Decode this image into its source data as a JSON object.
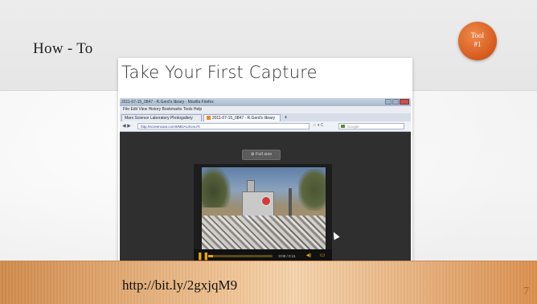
{
  "slide": {
    "title": "How - To",
    "badge": {
      "line1": "Tool",
      "line2": "#1"
    },
    "footer_url": "http://bit.ly/2gxjqM9",
    "page_number": "7"
  },
  "screenshot": {
    "heading": "Take Your First Capture",
    "browser": {
      "window_title": "2011-07-15_0847 - R.Gerd's library - Mozilla Firefox",
      "menu": "File  Edit  View  History  Bookmarks  Tools  Help",
      "tabs": [
        {
          "label": "Mars Science Laboratory Photogallery"
        },
        {
          "label": "2011-07-15_0847 - R.Gerd's library"
        }
      ],
      "url": "http://screencast.com/t/MDAUXcvuTt",
      "search_placeholder": "Google",
      "fullsize_button": "Full size",
      "video": {
        "time": "0:00 / 0:11",
        "progress": 0.08
      }
    }
  }
}
